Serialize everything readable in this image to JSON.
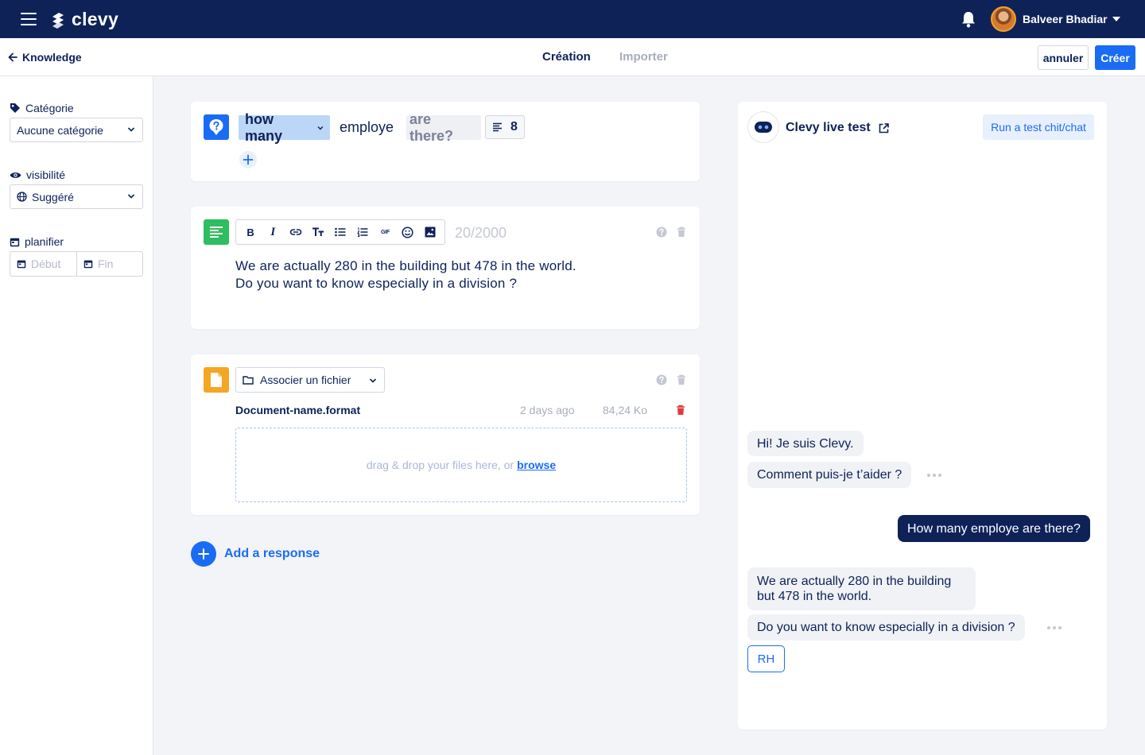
{
  "app": {
    "logo_text": "clevy"
  },
  "topbar": {
    "user_name": "Balveer Bhadiar"
  },
  "subbar": {
    "back_label": "Knowledge",
    "tabs": [
      {
        "label": "Création",
        "active": true
      },
      {
        "label": "Importer",
        "active": false
      }
    ],
    "cancel_label": "annuler",
    "create_label": "Créer"
  },
  "sidebar": {
    "category_label": "Catégorie",
    "category_value": "Aucune catégorie",
    "visibility_label": "visibilité",
    "visibility_value": "Suggéré",
    "schedule_label": "planifier",
    "start_placeholder": "Début",
    "end_placeholder": "Fin"
  },
  "question": {
    "keyword": "how many",
    "word": "employe",
    "phrase": "are there?",
    "variant_count": "8"
  },
  "text_response": {
    "char_count": "20/2000",
    "line1": "We are actually 280 in the building but 478 in the world.",
    "line2": "Do you want to know especially in a division ?"
  },
  "file_response": {
    "select_label": "Associer un fichier",
    "file_name": "Document-name.format",
    "file_date": "2 days ago",
    "file_size": "84,24 Ko",
    "dropzone_text": "drag & drop your files here, or",
    "browse_label": "browse"
  },
  "add_response_label": "Add a response",
  "live_test": {
    "title": "Clevy live test",
    "run_label": "Run a test chit/chat",
    "messages": [
      {
        "from": "bot",
        "text": "Hi! Je suis Clevy."
      },
      {
        "from": "bot",
        "text": "Comment puis-je t’aider ?"
      },
      {
        "from": "user",
        "text": "How many employe are there?"
      },
      {
        "from": "bot",
        "text": "We are actually 280 in the building but 478 in the world."
      },
      {
        "from": "bot",
        "text": "Do you want to know especially in a division ?"
      }
    ],
    "quick_reply": "RH"
  },
  "colors": {
    "navy": "#0e2258",
    "accent_blue": "#1a6cf5",
    "question_tile": "#1a6cf5",
    "text_tile": "#2ebd5f",
    "file_tile": "#f5a623",
    "danger": "#e03a3a"
  },
  "icons": [
    "menu-icon",
    "bell-icon",
    "arrow-left-icon",
    "tag-icon",
    "eye-icon",
    "globe-icon",
    "calendar-icon",
    "question-icon",
    "lines-icon",
    "plus-icon",
    "text-icon",
    "bold-icon",
    "italic-icon",
    "link-icon",
    "text-size-icon",
    "bullet-list-icon",
    "numbered-list-icon",
    "gif-icon",
    "emoji-icon",
    "image-icon",
    "help-icon",
    "trash-icon",
    "file-icon",
    "folder-icon",
    "chevron-down-icon",
    "robot-icon",
    "external-link-icon"
  ]
}
